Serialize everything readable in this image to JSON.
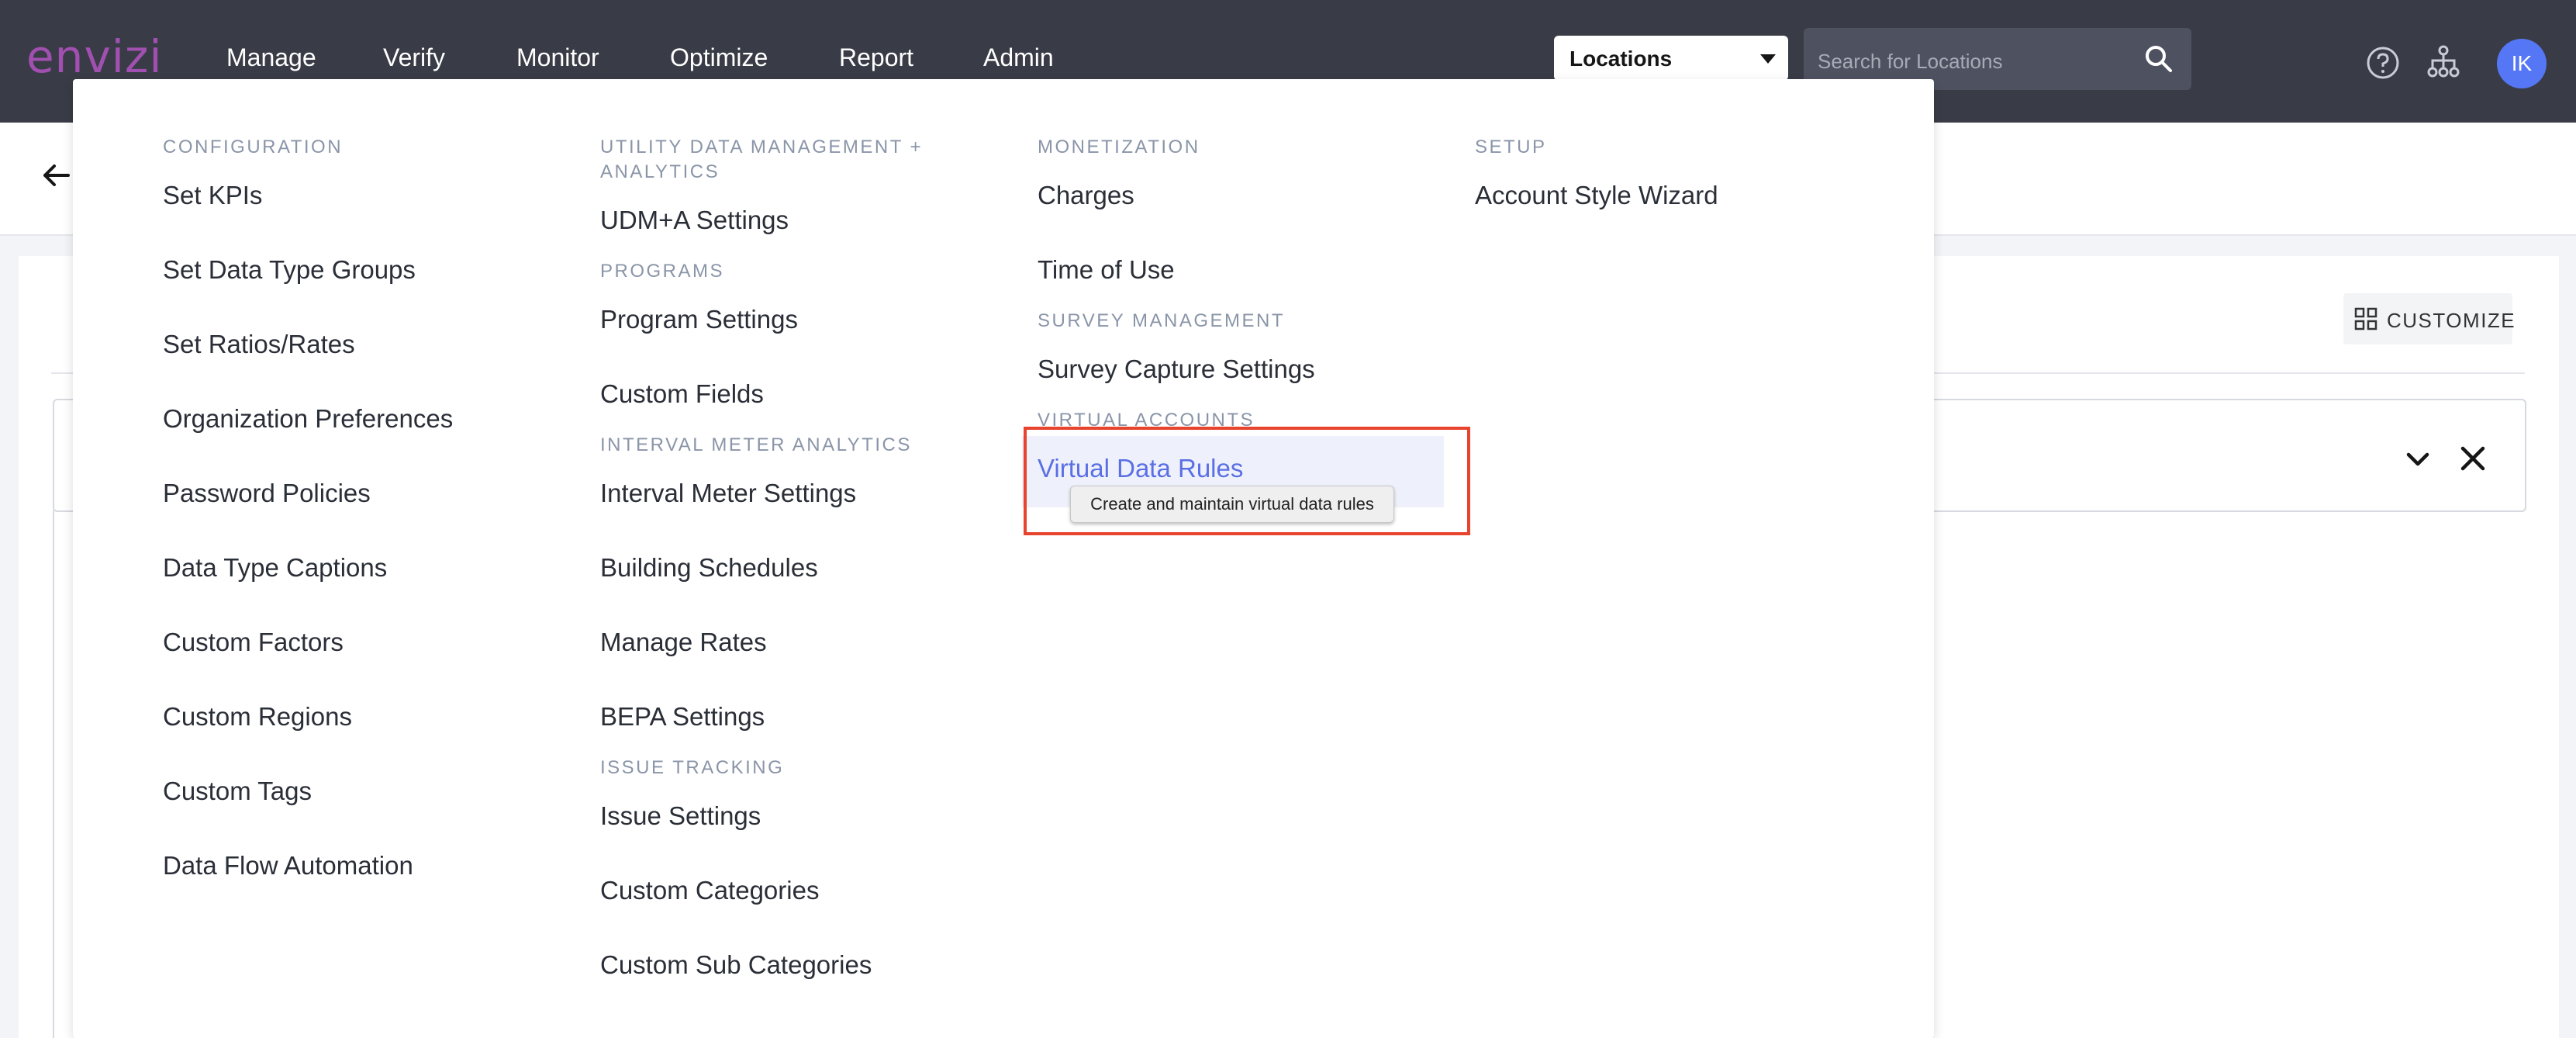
{
  "topbar": {
    "logo": "envizi",
    "nav": [
      "Manage",
      "Verify",
      "Monitor",
      "Optimize",
      "Report",
      "Admin"
    ],
    "location_select": "Locations",
    "search_placeholder": "Search for Locations",
    "avatar_initials": "IK"
  },
  "page": {
    "customize_label": "CUSTOMIZE"
  },
  "menu": {
    "col1": {
      "configuration": "CONFIGURATION",
      "set_kpis": "Set KPIs",
      "set_data_type_groups": "Set Data Type Groups",
      "set_ratios": "Set Ratios/Rates",
      "org_prefs": "Organization Preferences",
      "password_policies": "Password Policies",
      "data_type_captions": "Data Type Captions",
      "custom_factors": "Custom Factors",
      "custom_regions": "Custom Regions",
      "custom_tags": "Custom Tags",
      "data_flow_automation": "Data Flow Automation"
    },
    "col2": {
      "udm_line1": "UTILITY DATA MANAGEMENT +",
      "udm_line2": "ANALYTICS",
      "udm_settings": "UDM+A Settings",
      "programs": "PROGRAMS",
      "program_settings": "Program Settings",
      "custom_fields": "Custom Fields",
      "interval_meter_analytics": "INTERVAL METER ANALYTICS",
      "interval_meter_settings": "Interval Meter Settings",
      "building_schedules": "Building Schedules",
      "manage_rates": "Manage Rates",
      "bepa_settings": "BEPA Settings",
      "issue_tracking": "ISSUE TRACKING",
      "issue_settings": "Issue Settings",
      "custom_categories": "Custom Categories",
      "custom_sub_categories": "Custom Sub Categories"
    },
    "col3": {
      "monetization": "MONETIZATION",
      "charges": "Charges",
      "time_of_use": "Time of Use",
      "survey_management": "SURVEY MANAGEMENT",
      "survey_capture_settings": "Survey Capture Settings",
      "virtual_accounts": "VIRTUAL ACCOUNTS",
      "virtual_data_rules": "Virtual Data Rules",
      "tooltip": "Create and maintain virtual data rules"
    },
    "col4": {
      "setup": "SETUP",
      "account_style_wizard": "Account Style Wizard"
    }
  },
  "colors": {
    "topbar": "#393c46",
    "logo": "#a14fb0",
    "active_item": "#5a6fe4",
    "highlight_box": "#e8432c",
    "avatar": "#5577f5"
  },
  "icons": [
    "search-icon",
    "help-icon",
    "hierarchy-icon",
    "back-arrow-icon",
    "grid-icon",
    "chevron-down-icon",
    "close-icon",
    "caret-down-icon"
  ]
}
